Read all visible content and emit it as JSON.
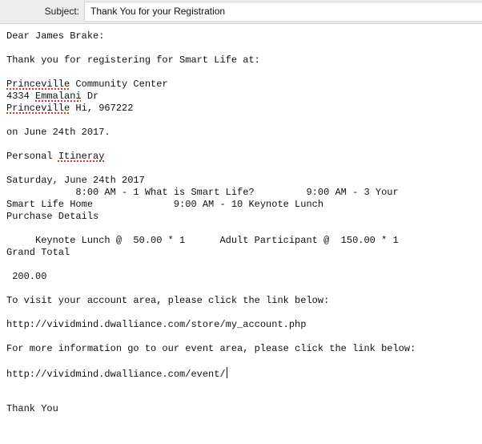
{
  "header": {
    "subject_label": "Subject:",
    "subject_value": "Thank You for your Registration"
  },
  "message": {
    "greeting": "Dear James Brake:",
    "intro": "Thank you for registering for Smart Life at:",
    "venue_w1": "Princeville",
    "venue_w2": " Community Center",
    "addr_num": "4334 ",
    "addr_street": "Emmalani",
    "addr_suffix": " Dr",
    "city": "Princeville",
    "city_rest": " Hi, 967222",
    "date_line": "on June 24th 2017.",
    "itin_prefix": "Personal ",
    "itin_word": "Itineray",
    "day_heading": "Saturday, June 24th 2017",
    "schedule_line1": "            8:00 AM - 1 What is Smart Life?         9:00 AM - 3 Your",
    "schedule_line2": "Smart Life Home              9:00 AM - 10 Keynote Lunch",
    "purchase_heading": "Purchase Details",
    "purchase_line": "     Keynote Lunch @  50.00 * 1      Adult Participant @  150.00 * 1",
    "grand_total_label": "Grand Total",
    "grand_total_value": " 200.00",
    "account_text": "To visit your account area, please click the link below:",
    "account_link": "http://vividmind.dwalliance.com/store/my_account.php",
    "event_text": "For more information go to our event area, please click the link below:",
    "event_link": "http://vividmind.dwalliance.com/event/",
    "closing": "Thank You"
  }
}
